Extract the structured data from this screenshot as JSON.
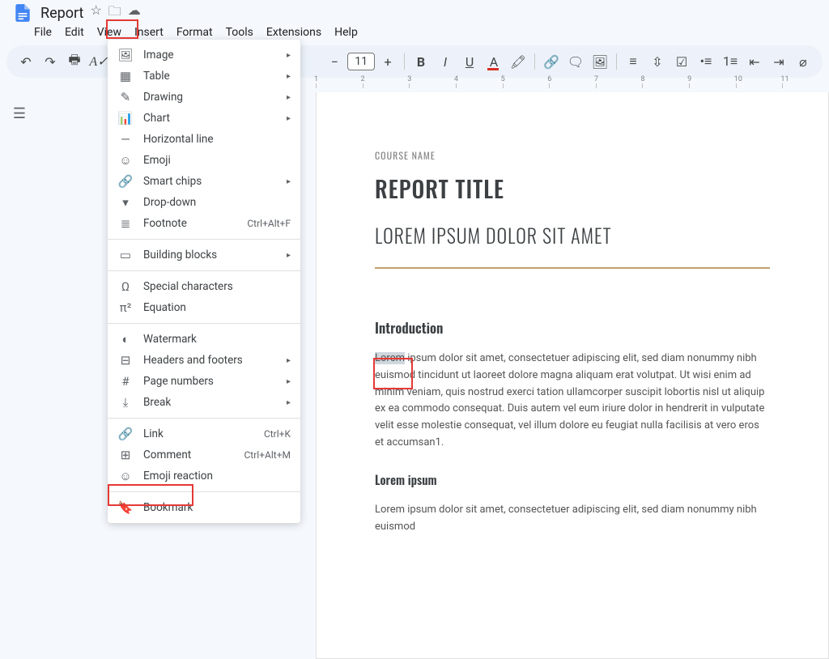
{
  "header": {
    "doc_title": "Report"
  },
  "menubar": [
    "File",
    "Edit",
    "View",
    "Insert",
    "Format",
    "Tools",
    "Extensions",
    "Help"
  ],
  "toolbar": {
    "font_size": "11"
  },
  "ruler_ticks": [
    "1",
    "2",
    "3",
    "4",
    "5",
    "6",
    "7",
    "8",
    "9",
    "10",
    "11"
  ],
  "dropdown": {
    "groups": [
      [
        {
          "icon": "🖼",
          "label": "Image",
          "sub": true
        },
        {
          "icon": "▦",
          "label": "Table",
          "sub": true
        },
        {
          "icon": "✎",
          "label": "Drawing",
          "sub": true
        },
        {
          "icon": "📊",
          "label": "Chart",
          "sub": true
        },
        {
          "icon": "―",
          "label": "Horizontal line"
        },
        {
          "icon": "☺",
          "label": "Emoji"
        },
        {
          "icon": "🔗",
          "label": "Smart chips",
          "sub": true
        },
        {
          "icon": "▾",
          "label": "Drop-down"
        },
        {
          "icon": "≣",
          "label": "Footnote",
          "shortcut": "Ctrl+Alt+F"
        }
      ],
      [
        {
          "icon": "▭",
          "label": "Building blocks",
          "sub": true
        }
      ],
      [
        {
          "icon": "Ω",
          "label": "Special characters"
        },
        {
          "icon": "π²",
          "label": "Equation"
        }
      ],
      [
        {
          "icon": "◐",
          "label": "Watermark"
        },
        {
          "icon": "⊟",
          "label": "Headers and footers",
          "sub": true
        },
        {
          "icon": "#",
          "label": "Page numbers",
          "sub": true
        },
        {
          "icon": "⤓",
          "label": "Break",
          "sub": true
        }
      ],
      [
        {
          "icon": "🔗",
          "label": "Link",
          "shortcut": "Ctrl+K"
        },
        {
          "icon": "⊞",
          "label": "Comment",
          "shortcut": "Ctrl+Alt+M"
        },
        {
          "icon": "☺",
          "label": "Emoji reaction"
        }
      ],
      [
        {
          "icon": "🔖",
          "label": "Bookmark"
        }
      ]
    ]
  },
  "document": {
    "eyebrow": "COURSE NAME",
    "title": "REPORT TITLE",
    "subtitle": "LOREM IPSUM DOLOR SIT AMET",
    "h2": "Introduction",
    "selected_word": "Lorem",
    "para_rest": " ipsum dolor sit amet, consectetuer adipiscing elit, sed diam nonummy nibh euismod tincidunt ut laoreet dolore magna aliquam erat volutpat. Ut wisi enim ad minim veniam, quis nostrud exerci tation ullamcorper suscipit lobortis nisl ut aliquip ex ea commodo consequat. Duis autem vel eum iriure dolor in hendrerit in vulputate velit esse molestie consequat, vel illum dolore eu feugiat nulla facilisis at vero eros et accumsan1.",
    "h3": "Lorem ipsum",
    "para2": "Lorem ipsum dolor sit amet, consectetuer adipiscing elit, sed diam nonummy nibh euismod"
  }
}
